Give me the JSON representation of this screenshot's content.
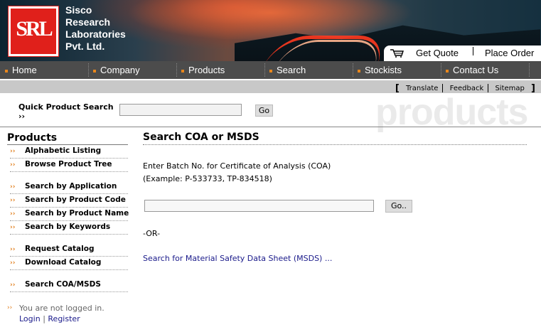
{
  "header": {
    "logo_text": "SRL",
    "company_lines": [
      "Sisco",
      "Research",
      "Laboratories",
      "Pvt. Ltd."
    ],
    "get_quote": "Get Quote",
    "place_order": "Place Order"
  },
  "nav": {
    "items": [
      {
        "label": "Home"
      },
      {
        "label": "Company"
      },
      {
        "label": "Products"
      },
      {
        "label": "Search"
      },
      {
        "label": "Stockists"
      },
      {
        "label": "Contact Us"
      }
    ]
  },
  "utility": {
    "open_bracket": "[",
    "translate": "Translate",
    "feedback": "Feedback",
    "sitemap": "Sitemap",
    "close_bracket": "]"
  },
  "quick_search": {
    "label_line1": "Quick Product Search",
    "label_line2": "››",
    "value": "",
    "button": "Go"
  },
  "watermark": "products",
  "sidebar": {
    "title": "Products",
    "items": [
      {
        "label": "Alphabetic Listing"
      },
      {
        "label": "Browse Product Tree"
      },
      {
        "label": "Search by Application"
      },
      {
        "label": "Search by Product Code"
      },
      {
        "label": "Search by Product Name"
      },
      {
        "label": "Search by Keywords"
      },
      {
        "label": "Request Catalog"
      },
      {
        "label": "Download Catalog"
      },
      {
        "label": "Search COA/MSDS"
      }
    ],
    "arrow": "››",
    "login_status": "You are not logged in.",
    "login": "Login",
    "separator": "|",
    "register": "Register"
  },
  "main": {
    "title": "Search COA or MSDS",
    "instruction": "Enter Batch No. for Certificate of Analysis (COA)",
    "example": "(Example: P-533733, TP-834518)",
    "batch_value": "",
    "go_button": "Go..",
    "or_text": "-OR-",
    "msds_link": "Search for Material Safety Data Sheet (MSDS) ..."
  },
  "colors": {
    "nav_bg": "#4c4c4c",
    "accent": "#e8861c",
    "logo_red": "#e0201b",
    "link": "#1a1a8a"
  }
}
